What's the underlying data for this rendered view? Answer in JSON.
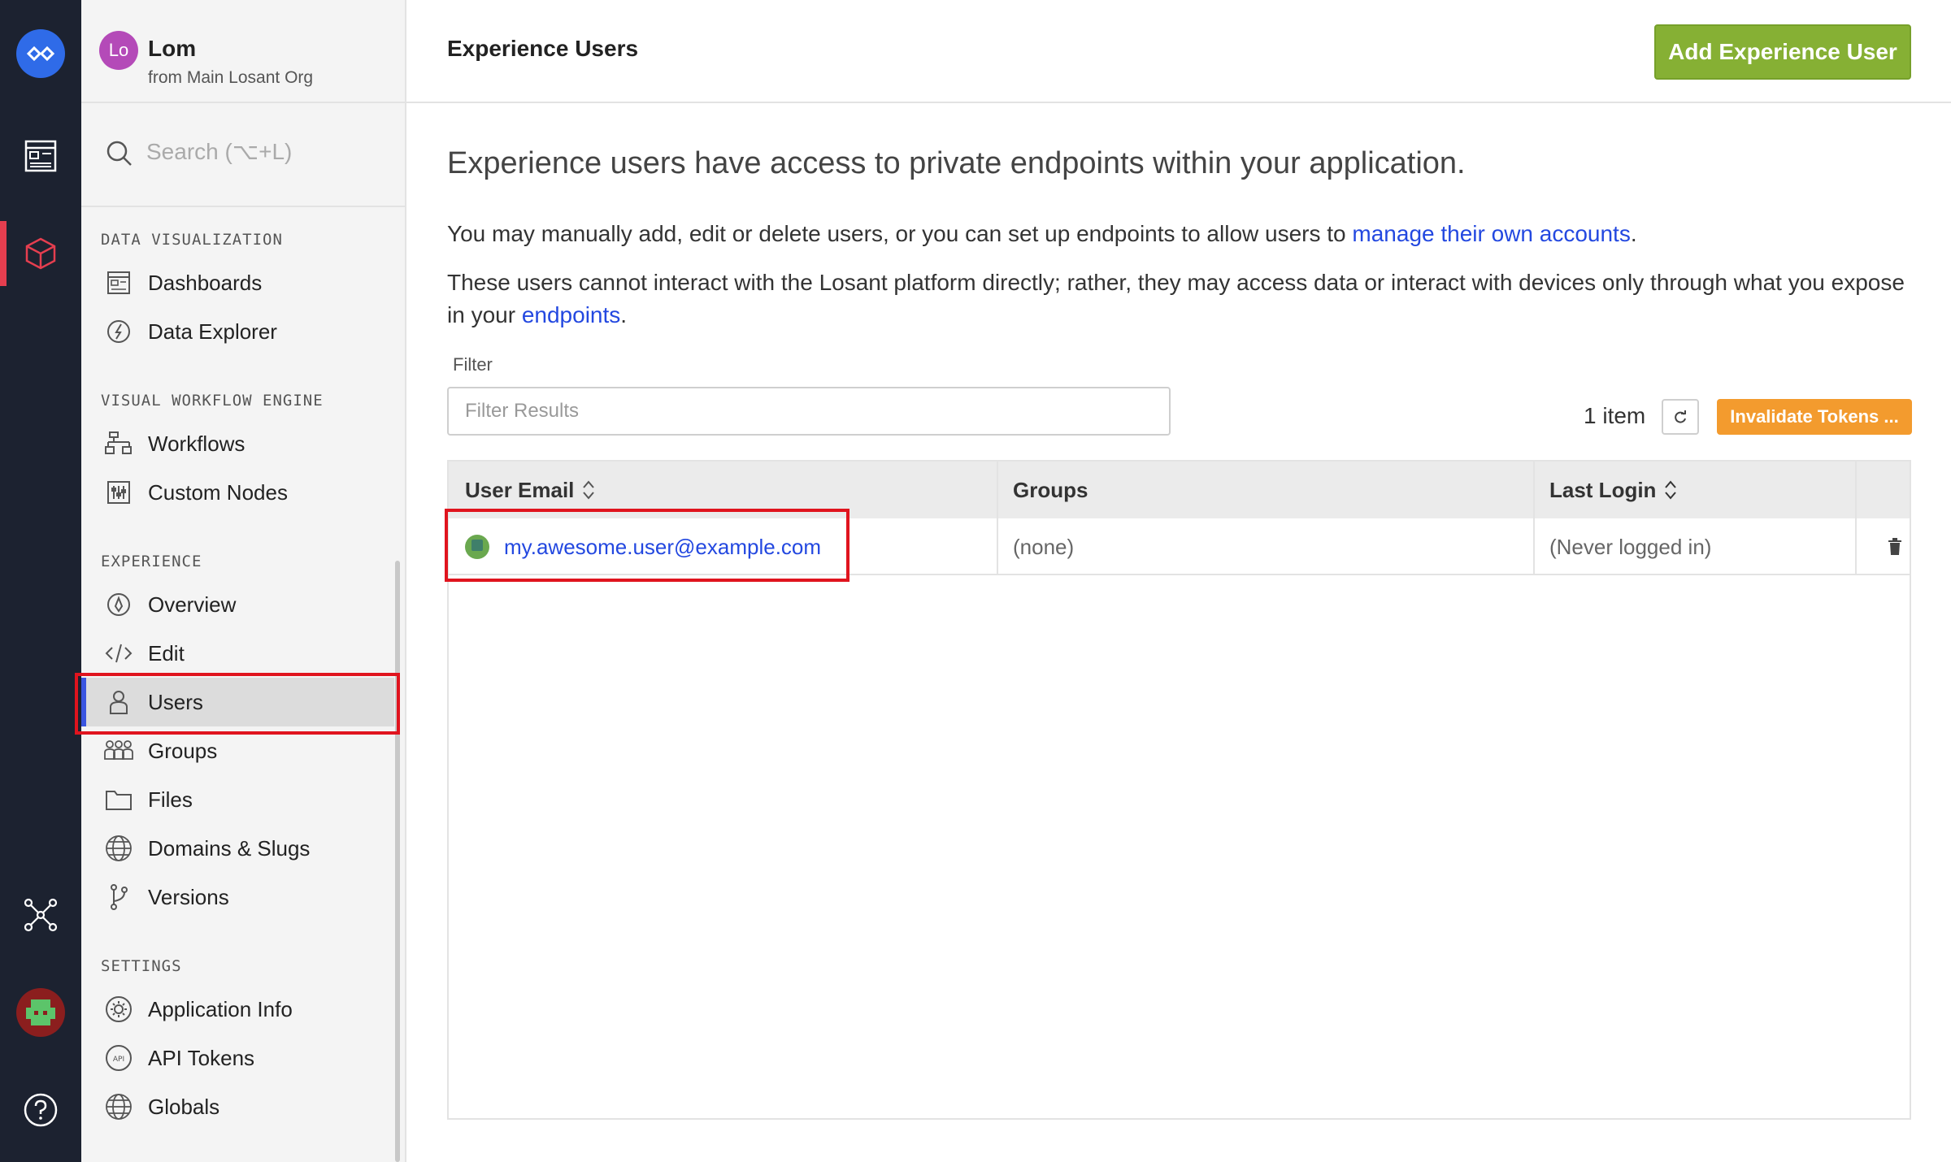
{
  "org": {
    "avatar": "Lo",
    "name": "Lom",
    "sub": "from Main Losant Org"
  },
  "search": {
    "placeholder": "Search (⌥+L)"
  },
  "sidebar": {
    "sections": [
      {
        "title": "DATA VISUALIZATION",
        "items": [
          {
            "label": "Dashboards",
            "icon": "dashboard-icon"
          },
          {
            "label": "Data Explorer",
            "icon": "compass-icon"
          }
        ]
      },
      {
        "title": "VISUAL WORKFLOW ENGINE",
        "items": [
          {
            "label": "Workflows",
            "icon": "workflow-icon"
          },
          {
            "label": "Custom Nodes",
            "icon": "sliders-icon"
          }
        ]
      },
      {
        "title": "EXPERIENCE",
        "items": [
          {
            "label": "Overview",
            "icon": "overview-icon"
          },
          {
            "label": "Edit",
            "icon": "code-icon"
          },
          {
            "label": "Users",
            "icon": "user-icon",
            "active": true
          },
          {
            "label": "Groups",
            "icon": "groups-icon"
          },
          {
            "label": "Files",
            "icon": "folder-icon"
          },
          {
            "label": "Domains & Slugs",
            "icon": "www-icon"
          },
          {
            "label": "Versions",
            "icon": "branch-icon"
          }
        ]
      },
      {
        "title": "SETTINGS",
        "items": [
          {
            "label": "Application Info",
            "icon": "gear-icon"
          },
          {
            "label": "API Tokens",
            "icon": "api-icon"
          },
          {
            "label": "Globals",
            "icon": "globe-icon"
          }
        ]
      }
    ]
  },
  "header": {
    "title": "Experience Users",
    "add_button": "Add Experience User"
  },
  "main": {
    "lead": "Experience users have access to private endpoints within your application.",
    "p1_text": "You may manually add, edit or delete users, or you can set up endpoints to allow users to ",
    "p1_link": "manage their own accounts",
    "p1_end": ".",
    "p2_text": "These users cannot interact with the Losant platform directly; rather, they may access data or interact with devices only through what you expose in your ",
    "p2_link": "endpoints",
    "p2_end": "."
  },
  "filter": {
    "label": "Filter",
    "placeholder": "Filter Results"
  },
  "toolbar": {
    "count": "1 item",
    "invalidate": "Invalidate Tokens ..."
  },
  "table": {
    "headers": {
      "email": "User Email",
      "groups": "Groups",
      "last_login": "Last Login"
    },
    "rows": [
      {
        "email": "my.awesome.user@example.com",
        "groups": "(none)",
        "last_login": "(Never logged in)"
      }
    ]
  },
  "colors": {
    "accent": "#2348e0",
    "add": "#86b034",
    "invalidate": "#f39b2e",
    "rail": "#1c2230",
    "highlight": "#e0141e"
  }
}
